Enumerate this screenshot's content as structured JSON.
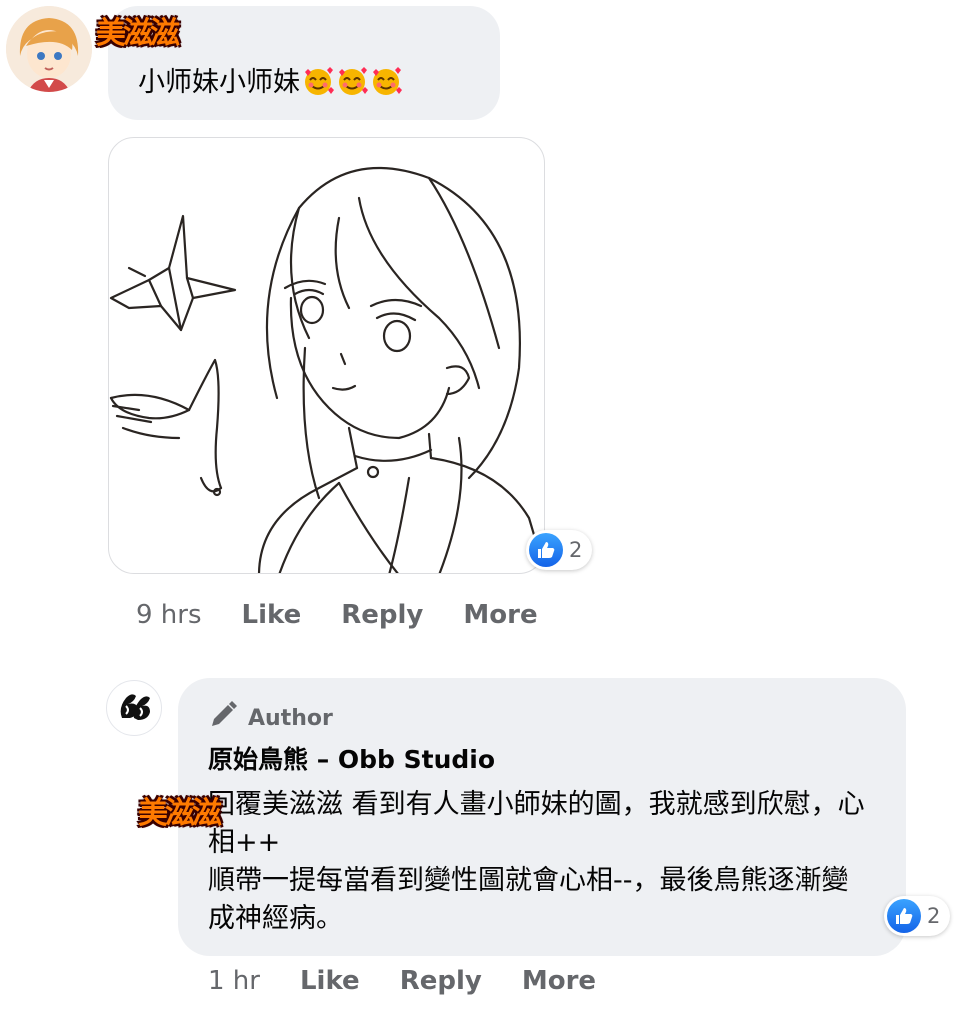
{
  "comment1": {
    "sticker_name": "美滋滋",
    "text": "小师妹小师妹",
    "emojis": [
      "smiling-face-with-hearts",
      "smiling-face-with-hearts",
      "smiling-face-with-hearts"
    ],
    "image_alt_icon": "anime-girl-with-paper-crane-drawing",
    "reaction_icon": "like-icon",
    "reaction_count": "2",
    "time": "9 hrs",
    "like_label": "Like",
    "reply_label": "Reply",
    "more_label": "More"
  },
  "comment2": {
    "badge_icon": "pencil-icon",
    "badge_label": "Author",
    "author_name": "原始鳥熊 – Obb Studio",
    "sticker_name": "美滋滋",
    "text": "回覆美滋滋 看到有人畫小師妹的圖，我就感到欣慰，心相++\n順帶一提每當看到變性圖就會心相--，最後鳥熊逐漸變成神經病。",
    "reaction_icon": "like-icon",
    "reaction_count": "2",
    "time": "1 hr",
    "like_label": "Like",
    "reply_label": "Reply",
    "more_label": "More"
  },
  "colors": {
    "bubble": "#eef0f3",
    "secondary_text": "#65676b",
    "like_blue": "#1877f2"
  }
}
